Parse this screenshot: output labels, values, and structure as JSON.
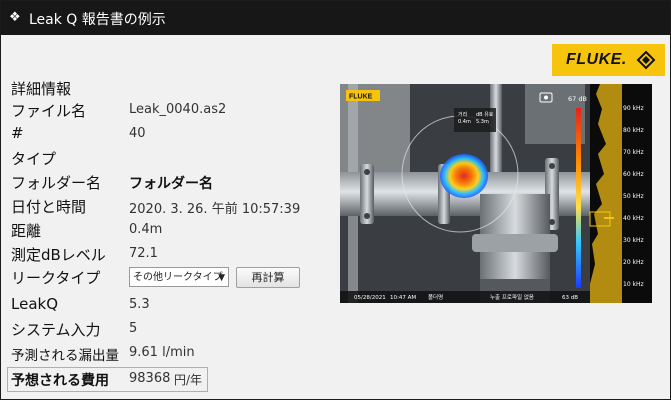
{
  "window": {
    "title_icon": "diamond-bullet-icon",
    "title": "Leak Q 報告書の例示"
  },
  "brand": {
    "logo_text": "FLUKE.",
    "color": "#f6c40d"
  },
  "section_heading": "詳細情報",
  "fields": {
    "file_name": {
      "label": "ファイル名",
      "value": "Leak_0040.as2"
    },
    "number": {
      "label": "#",
      "value": "40"
    },
    "type": {
      "label": "タイプ"
    },
    "folder_name": {
      "label": "フォルダー名",
      "value": "フォルダー名"
    },
    "datetime": {
      "label": "日付と時間",
      "value": "2020. 3. 26. 午前 10:57:39"
    },
    "distance": {
      "label": "距離",
      "value": "0.4m"
    },
    "measured_db": {
      "label": "測定dBレベル",
      "value": "72.1"
    },
    "leak_type": {
      "label": "リークタイプ",
      "selected": "その他リークタイプ",
      "recalc_button": "再計算"
    },
    "leakq": {
      "label": "LeakQ",
      "value": "5.3"
    },
    "system_input": {
      "label": "システム入力",
      "value": "5"
    },
    "predicted_flow": {
      "label": "予測される漏出量",
      "value": "9.61 l/min"
    },
    "estimated_cost": {
      "label": "予想される費用",
      "value": "98368",
      "unit": "円/年"
    }
  },
  "thermal_image": {
    "top_left_tag": "FLUKE",
    "db_top": "67 dB",
    "db_bottom": "63 dB",
    "freq_scale": [
      "90 kHz",
      "80 kHz",
      "70 kHz",
      "60 kHz",
      "50 kHz",
      "40 kHz",
      "30 kHz",
      "20 kHz",
      "10 kHz"
    ],
    "status_date": "05/28/2021",
    "status_time": "10:47 AM",
    "status_folder": "폴더명",
    "status_center": "누출 프로파일 없음",
    "center_box_line1": "거리",
    "center_box_line2": "0.4m",
    "center_box_line3": "dB 유효",
    "center_box_line4": "5.3m",
    "hot_color": "#e2231a",
    "accent_color": "#f5a623"
  }
}
